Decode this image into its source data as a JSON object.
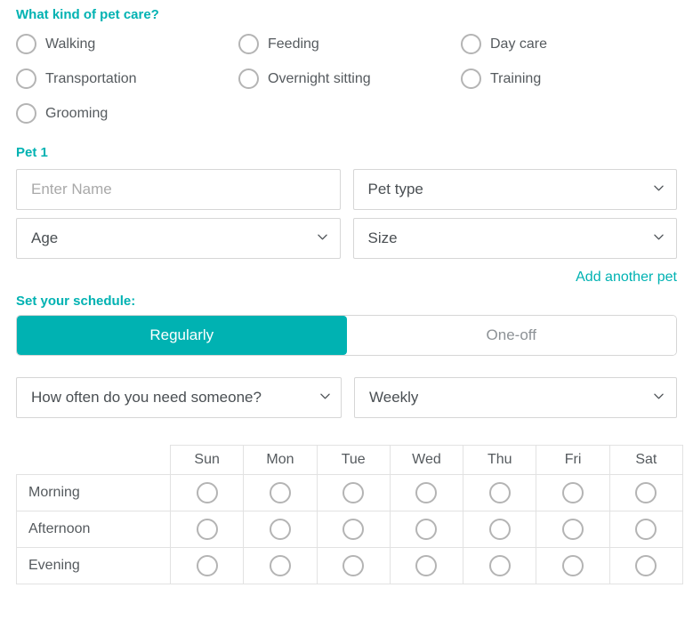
{
  "pet_care": {
    "heading": "What kind of pet care?",
    "options": [
      {
        "label": "Walking"
      },
      {
        "label": "Feeding"
      },
      {
        "label": "Day care"
      },
      {
        "label": "Transportation"
      },
      {
        "label": "Overnight sitting"
      },
      {
        "label": "Training"
      },
      {
        "label": "Grooming"
      }
    ]
  },
  "pet": {
    "heading": "Pet 1",
    "name_placeholder": "Enter Name",
    "name_value": "",
    "pet_type_value": "Pet type",
    "age_value": "Age",
    "size_value": "Size",
    "add_another_label": "Add another pet"
  },
  "schedule": {
    "heading": "Set your schedule:",
    "toggle": {
      "regular_label": "Regularly",
      "oneoff_label": "One-off",
      "active": "Regularly"
    },
    "frequency_value": "How often do you need someone?",
    "period_value": "Weekly",
    "table": {
      "corner_label": "",
      "days": [
        "Sun",
        "Mon",
        "Tue",
        "Wed",
        "Thu",
        "Fri",
        "Sat"
      ],
      "rows": [
        {
          "label": "Morning"
        },
        {
          "label": "Afternoon"
        },
        {
          "label": "Evening"
        }
      ]
    }
  },
  "colors": {
    "accent": "#00b2b2",
    "text": "#555a5e",
    "border": "#d6d6d6",
    "table_border": "#e2e2e2",
    "circle_border": "#b4b4b4",
    "placeholder": "#a9a9a9"
  },
  "icons": {
    "chevron_down": "chevron-down-icon"
  }
}
